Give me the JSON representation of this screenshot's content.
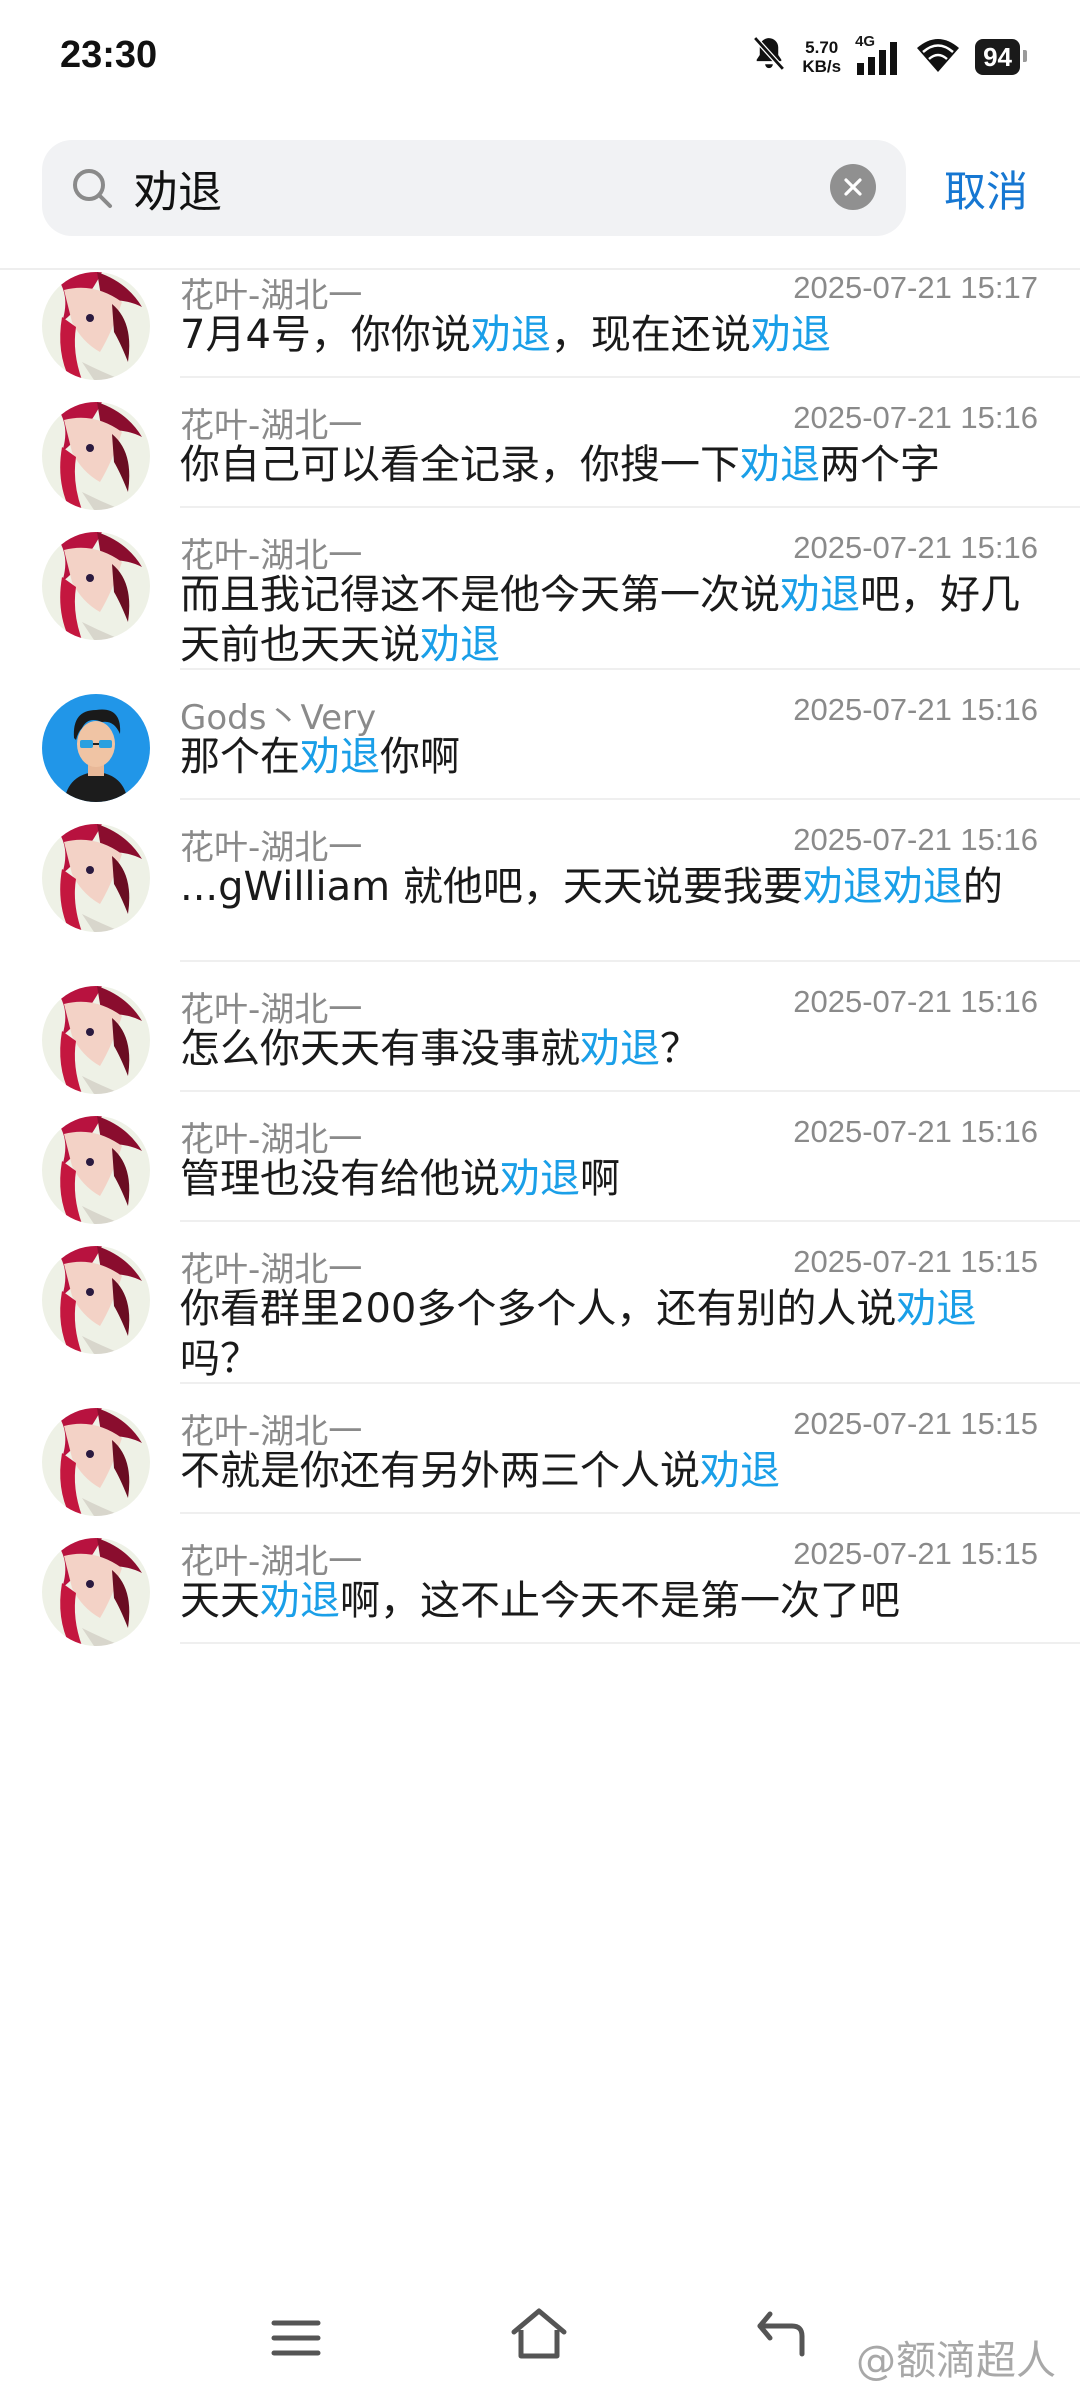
{
  "status_bar": {
    "time": "23:30",
    "net_speed_value": "5.70",
    "net_speed_unit": "KB/s",
    "network": "4G",
    "battery": "94",
    "icons": [
      "bell-off-icon",
      "signal-icon",
      "wifi-icon",
      "battery-icon"
    ]
  },
  "search": {
    "query": "劝退",
    "cancel_label": "取消"
  },
  "colors": {
    "highlight": "#1a9fe8",
    "cancel": "#1677d2",
    "muted_text": "#8a8a8a"
  },
  "results": [
    {
      "sender": "花叶-湖北一",
      "time": "2025-07-21 15:17",
      "avatar": "anime-avatar",
      "parts": [
        {
          "t": "7月4号，你你说"
        },
        {
          "t": "劝退",
          "hl": true
        },
        {
          "t": "，现在还说"
        },
        {
          "t": "劝退",
          "hl": true
        }
      ]
    },
    {
      "sender": "花叶-湖北一",
      "time": "2025-07-21 15:16",
      "avatar": "anime-avatar",
      "parts": [
        {
          "t": "你自己可以看全记录，你搜一下"
        },
        {
          "t": "劝退",
          "hl": true
        },
        {
          "t": "两个字"
        }
      ]
    },
    {
      "sender": "花叶-湖北一",
      "time": "2025-07-21 15:16",
      "avatar": "anime-avatar",
      "parts": [
        {
          "t": "而且我记得这不是他今天第一次说"
        },
        {
          "t": "劝退",
          "hl": true
        },
        {
          "t": "吧，好几天前也天天说"
        },
        {
          "t": "劝退",
          "hl": true
        }
      ]
    },
    {
      "sender": "Gods丶Very",
      "time": "2025-07-21 15:16",
      "avatar": "cartoon-man-avatar",
      "parts": [
        {
          "t": "那个在"
        },
        {
          "t": "劝退",
          "hl": true
        },
        {
          "t": "你啊"
        }
      ]
    },
    {
      "sender": "花叶-湖北一",
      "time": "2025-07-21 15:16",
      "avatar": "anime-avatar",
      "parts": [
        {
          "t": "...gWilliam  就他吧，天天说要我要"
        },
        {
          "t": "劝退劝退",
          "hl": true
        },
        {
          "t": "的"
        }
      ]
    },
    {
      "sender": "花叶-湖北一",
      "time": "2025-07-21 15:16",
      "avatar": "anime-avatar",
      "parts": [
        {
          "t": "怎么你天天有事没事就"
        },
        {
          "t": "劝退",
          "hl": true
        },
        {
          "t": "？"
        }
      ]
    },
    {
      "sender": "花叶-湖北一",
      "time": "2025-07-21 15:16",
      "avatar": "anime-avatar",
      "parts": [
        {
          "t": "管理也没有给他说"
        },
        {
          "t": "劝退",
          "hl": true
        },
        {
          "t": "啊"
        }
      ]
    },
    {
      "sender": "花叶-湖北一",
      "time": "2025-07-21 15:15",
      "avatar": "anime-avatar",
      "parts": [
        {
          "t": "你看群里200多个多个人，还有别的人说"
        },
        {
          "t": "劝退",
          "hl": true
        },
        {
          "t": "吗？"
        }
      ]
    },
    {
      "sender": "花叶-湖北一",
      "time": "2025-07-21 15:15",
      "avatar": "anime-avatar",
      "parts": [
        {
          "t": "不就是你还有另外两三个人说"
        },
        {
          "t": "劝退",
          "hl": true
        }
      ]
    },
    {
      "sender": "花叶-湖北一",
      "time": "2025-07-21 15:15",
      "avatar": "anime-avatar",
      "parts": [
        {
          "t": "天天"
        },
        {
          "t": "劝退",
          "hl": true
        },
        {
          "t": "啊，这不止今天不是第一次了吧"
        }
      ]
    }
  ],
  "nav": {
    "icons": [
      "menu-icon",
      "home-icon",
      "back-icon"
    ]
  },
  "watermark": "@额滴超人"
}
